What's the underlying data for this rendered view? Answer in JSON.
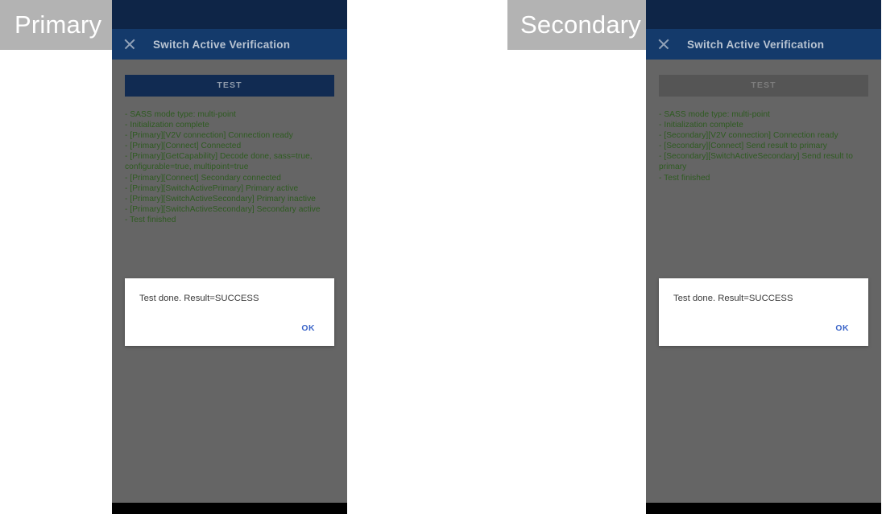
{
  "panels": [
    {
      "role_label": "Primary",
      "app_bar": {
        "title": "Switch Active Verification",
        "close_icon": "close-icon"
      },
      "test_button": {
        "label": "TEST",
        "disabled": false
      },
      "log_lines": [
        {
          "text": "SASS mode type: multi-point",
          "continuation": false
        },
        {
          "text": "Initialization complete",
          "continuation": false
        },
        {
          "text": "[Primary][V2V connection] Connection ready",
          "continuation": false
        },
        {
          "text": "[Primary][Connect] Connected",
          "continuation": false
        },
        {
          "text": "[Primary][GetCapability] Decode done, sass=true, configurable=true, multipoint=true",
          "continuation": false
        },
        {
          "text": "[Primary][Connect] Secondary connected",
          "continuation": false
        },
        {
          "text": "[Primary][SwitchActivePrimary] Primary active",
          "continuation": false
        },
        {
          "text": "[Primary][SwitchActiveSecondary] Primary inactive",
          "continuation": false
        },
        {
          "text": "[Primary][SwitchActiveSecondary] Secondary active",
          "continuation": false
        },
        {
          "text": "Test finished",
          "continuation": false
        }
      ],
      "dialog": {
        "message": "Test done. Result=SUCCESS",
        "ok_label": "OK"
      }
    },
    {
      "role_label": "Secondary",
      "app_bar": {
        "title": "Switch Active Verification",
        "close_icon": "close-icon"
      },
      "test_button": {
        "label": "TEST",
        "disabled": true
      },
      "log_lines": [
        {
          "text": "SASS mode type: multi-point",
          "continuation": false
        },
        {
          "text": "Initialization complete",
          "continuation": false
        },
        {
          "text": "[Secondary][V2V connection] Connection ready",
          "continuation": false
        },
        {
          "text": "[Secondary][Connect] Send result to primary",
          "continuation": false
        },
        {
          "text": "[Secondary][SwitchActiveSecondary] Send result to primary",
          "continuation": false
        },
        {
          "text": "Test finished",
          "continuation": false
        }
      ],
      "dialog": {
        "message": "Test done. Result=SUCCESS",
        "ok_label": "OK"
      }
    }
  ],
  "colors": {
    "status_bar": "#0e2547",
    "app_bar": "#143a6b",
    "screen_background": "#656565",
    "test_button": "#112b52",
    "test_button_disabled": "#555555",
    "log_text": "#2e5b20",
    "dialog_background": "#ffffff",
    "dialog_action": "#3a64c8",
    "role_badge": "#b3b3b3",
    "nav_bar": "#000000"
  }
}
